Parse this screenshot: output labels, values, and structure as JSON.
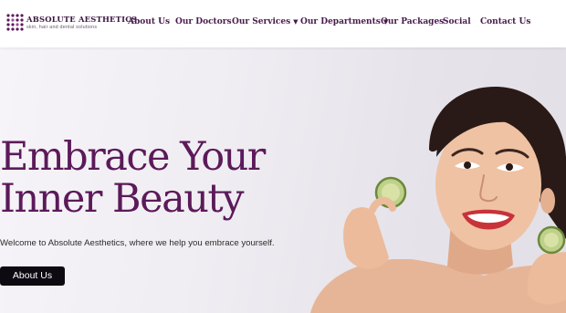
{
  "brand": {
    "name": "ABSOLUTE AESTHETICS",
    "tagline": "skin, hair and dental solutions",
    "logo_icon": "dotted-square-logo-icon",
    "colors": {
      "primary": "#5c1a5a",
      "nav_text": "#4a1a4e",
      "button_bg": "#0d0a12"
    }
  },
  "nav": {
    "items": [
      {
        "label": "About Us",
        "has_dropdown": false
      },
      {
        "label": "Our Doctors",
        "has_dropdown": false
      },
      {
        "label": "Our Services",
        "has_dropdown": true
      },
      {
        "label": "Our Departments",
        "has_dropdown": true
      },
      {
        "label": "Our Packages",
        "has_dropdown": false
      },
      {
        "label": "Social",
        "has_dropdown": false
      },
      {
        "label": "Contact Us",
        "has_dropdown": false
      }
    ],
    "dropdown_icon": "chevron-down-icon"
  },
  "hero": {
    "title_line1": "Embrace Your",
    "title_line2": "Inner Beauty",
    "subtitle": "Welcome to Absolute Aesthetics, where we help you embrace yourself.",
    "cta_label": "About Us",
    "image": "woman-holding-cucumber-slices-photo"
  }
}
